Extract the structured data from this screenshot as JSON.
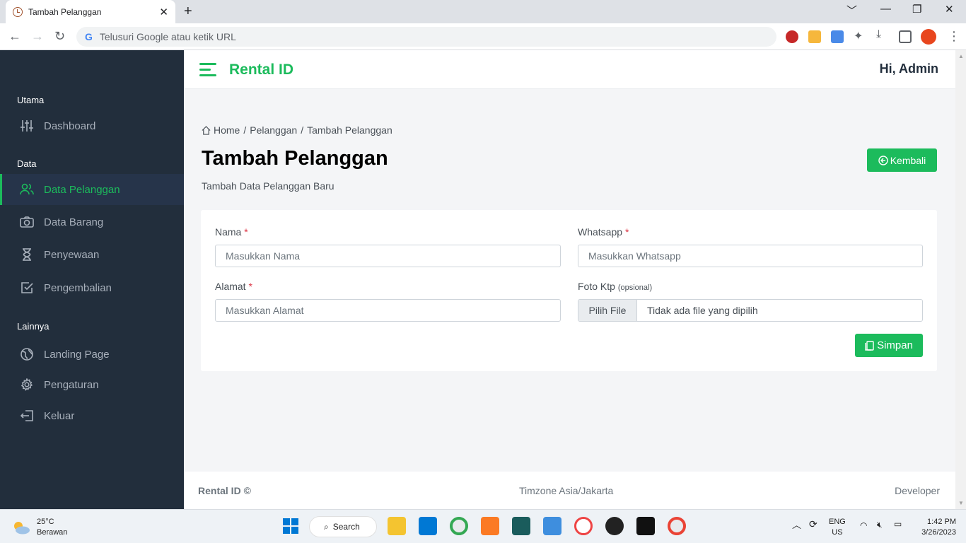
{
  "browser": {
    "tab_title": "Tambah Pelanggan",
    "tab_close": "✕",
    "new_tab": "+",
    "address_placeholder": "Telusuri Google atau ketik URL",
    "win_min": "﹀",
    "win_min2": "—",
    "win_restore": "❐",
    "win_close": "✕"
  },
  "sidebar": {
    "sections": [
      {
        "heading": "Utama"
      },
      {
        "heading": "Data"
      },
      {
        "heading": "Lainnya"
      }
    ],
    "items": [
      {
        "label": "Dashboard",
        "icon": "sliders-icon"
      },
      {
        "label": "Data Pelanggan",
        "icon": "users-icon",
        "active": true
      },
      {
        "label": "Data Barang",
        "icon": "camera-icon"
      },
      {
        "label": "Penyewaan",
        "icon": "hourglass-icon"
      },
      {
        "label": "Pengembalian",
        "icon": "check-square-icon"
      },
      {
        "label": "Landing Page",
        "icon": "globe-icon"
      },
      {
        "label": "Pengaturan",
        "icon": "gear-icon"
      },
      {
        "label": "Keluar",
        "icon": "logout-icon"
      }
    ]
  },
  "topnav": {
    "brand": "Rental ID",
    "greeting": "Hi, Admin"
  },
  "breadcrumb": {
    "home": "Home",
    "sep1": "/",
    "level1": "Pelanggan",
    "sep2": "/",
    "current": "Tambah Pelanggan"
  },
  "page": {
    "title": "Tambah Pelanggan",
    "subtitle": "Tambah Data Pelanggan Baru",
    "back_button": "Kembali"
  },
  "form": {
    "nama_label": "Nama",
    "nama_placeholder": "Masukkan Nama",
    "whatsapp_label": "Whatsapp",
    "whatsapp_placeholder": "Masukkan Whatsapp",
    "alamat_label": "Alamat",
    "alamat_placeholder": "Masukkan Alamat",
    "foto_label": "Foto Ktp",
    "foto_optional": "(opsional)",
    "file_button": "Pilih File",
    "file_status": "Tidak ada file yang dipilih",
    "required_mark": "*",
    "submit": "Simpan"
  },
  "footer": {
    "left": "Rental ID ©",
    "middle": "Timzone Asia/Jakarta",
    "right": "Developer"
  },
  "taskbar": {
    "temperature": "25°C",
    "weather": "Berawan",
    "search": "Search",
    "lang": "ENG",
    "region": "US",
    "time": "1:42 PM",
    "date": "3/26/2023"
  },
  "colors": {
    "accent": "#1cbb5c",
    "sidebar": "#222e3c",
    "required": "#dc3545"
  }
}
